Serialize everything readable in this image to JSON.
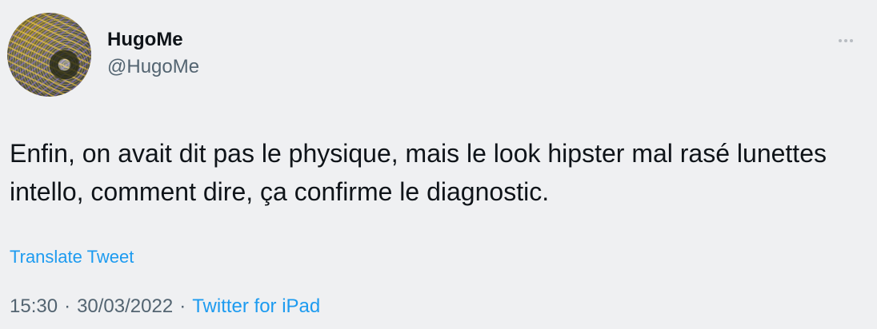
{
  "tweet": {
    "author": {
      "display_name": "HugoMe",
      "handle": "@HugoMe",
      "avatar_icon": "profile-photo"
    },
    "more_icon": "more-options-icon",
    "text": "Enfin, on avait dit pas le physique, mais le look hipster mal rasé lunettes intello, comment dire, ça confirme le diagnostic.",
    "translate_label": "Translate Tweet",
    "time": "15:30",
    "separator": "·",
    "date": "30/03/2022",
    "source": "Twitter for iPad"
  },
  "colors": {
    "background": "#eff0f2",
    "text": "#0f1419",
    "secondary_text": "#536471",
    "link": "#1d9bf0"
  }
}
